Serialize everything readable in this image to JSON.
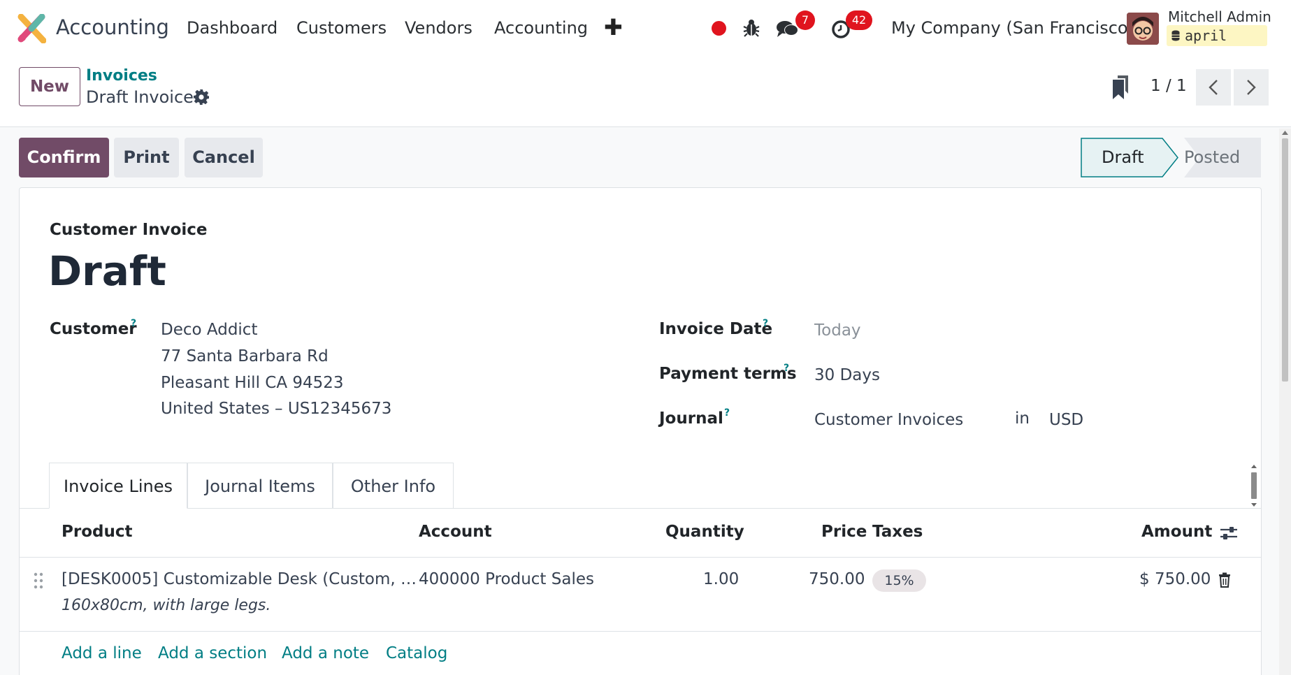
{
  "navbar": {
    "app_title": "Accounting",
    "menu": [
      "Dashboard",
      "Customers",
      "Vendors",
      "Accounting"
    ],
    "messages_count": "7",
    "activities_count": "42",
    "company": "My Company (San Francisco)",
    "user_name": "Mitchell Admin",
    "database": "april"
  },
  "control_panel": {
    "new_label": "New",
    "breadcrumb_parent": "Invoices",
    "breadcrumb_current": "Draft Invoice",
    "pager_value": "1 / 1"
  },
  "actions": {
    "confirm": "Confirm",
    "print": "Print",
    "cancel": "Cancel"
  },
  "statusbar": {
    "states": [
      "Draft",
      "Posted"
    ],
    "current": "Draft"
  },
  "invoice": {
    "type_label": "Customer Invoice",
    "name": "Draft",
    "customer_label": "Customer",
    "customer_lines": [
      "Deco Addict",
      "77 Santa Barbara Rd",
      "Pleasant Hill CA 94523",
      "United States – US12345673"
    ],
    "invoice_date_label": "Invoice Date",
    "invoice_date_placeholder": "Today",
    "payment_terms_label": "Payment terms",
    "payment_terms": "30 Days",
    "journal_label": "Journal",
    "journal": "Customer Invoices",
    "in_label": "in",
    "currency": "USD",
    "help_mark": "?"
  },
  "tabs": [
    "Invoice Lines",
    "Journal Items",
    "Other Info"
  ],
  "lines_table": {
    "headers": {
      "product": "Product",
      "account": "Account",
      "quantity": "Quantity",
      "price": "Price",
      "taxes": "Taxes",
      "amount": "Amount"
    },
    "rows": [
      {
        "product": "[DESK0005] Customizable Desk (Custom, …",
        "description": "160x80cm, with large legs.",
        "account": "400000 Product Sales",
        "quantity": "1.00",
        "price": "750.00",
        "tax": "15%",
        "amount": "$ 750.00"
      }
    ],
    "add_links": [
      "Add a line",
      "Add a section",
      "Add a note",
      "Catalog"
    ]
  },
  "colors": {
    "brand": "#714b67",
    "link": "#017e84",
    "badge": "#e0141e"
  }
}
